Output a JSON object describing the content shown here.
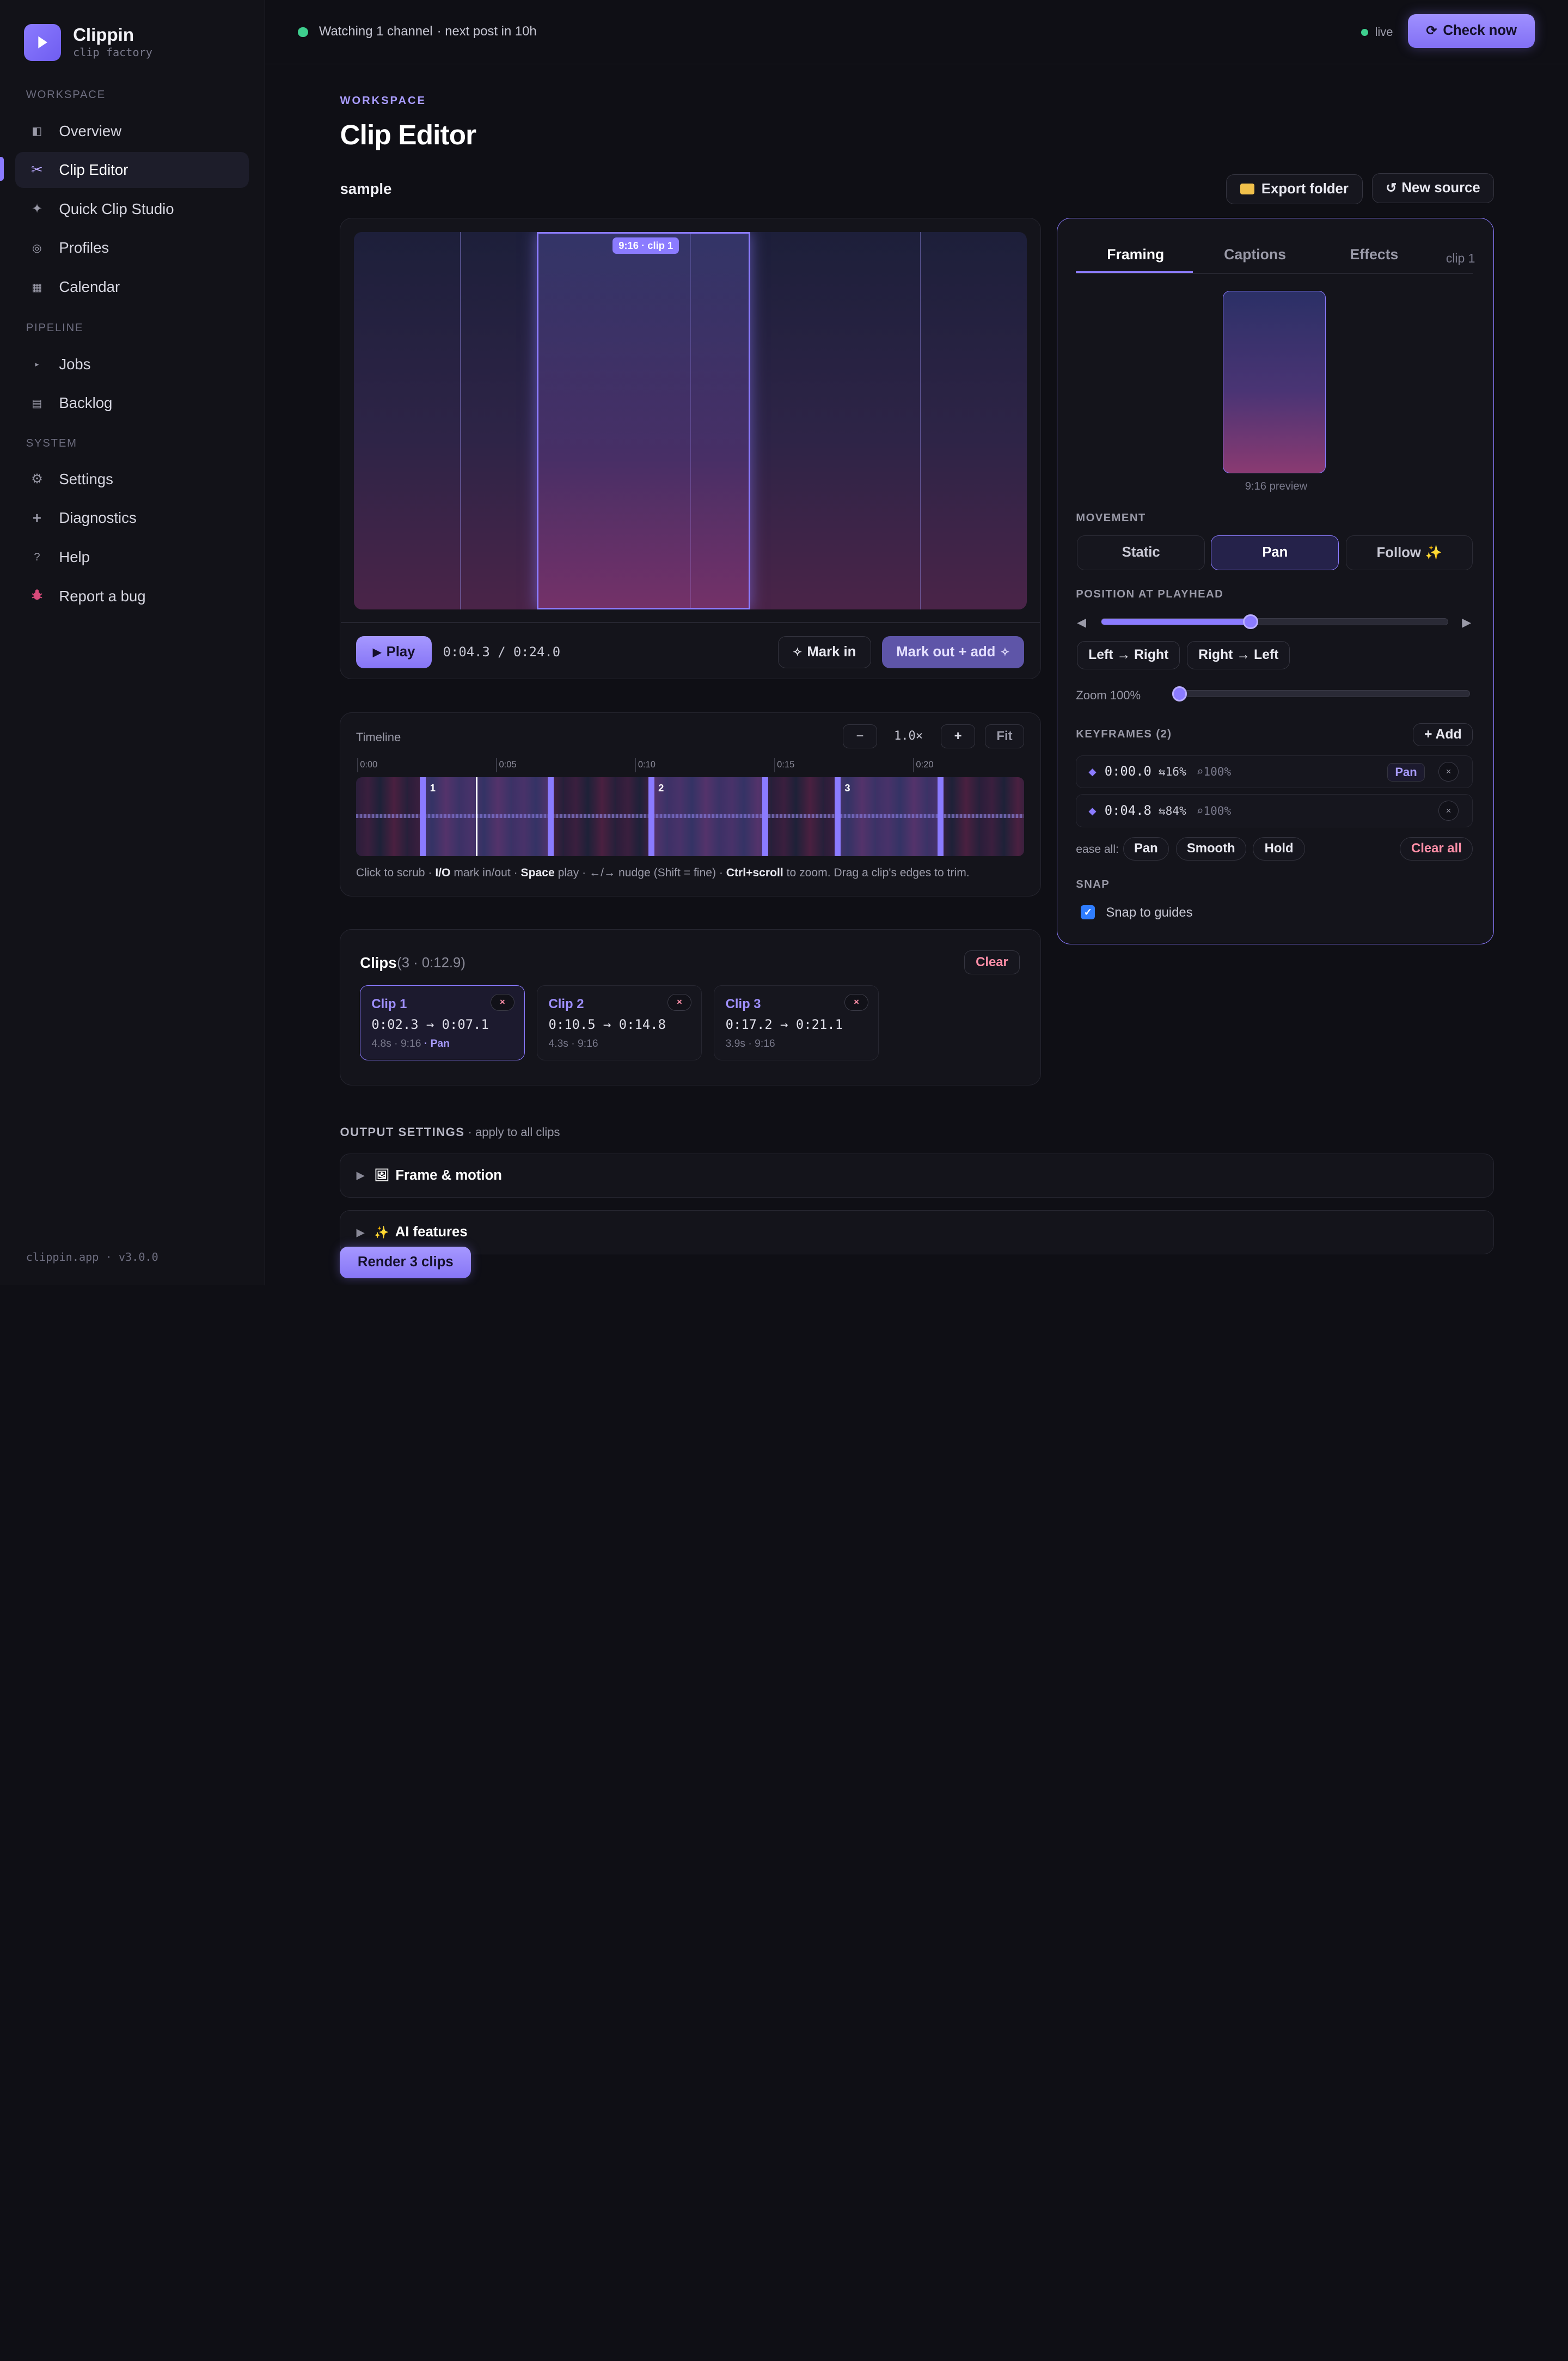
{
  "app": {
    "name": "Clippin",
    "tagline": "clip factory",
    "footer": "clippin.app · v3.0.0",
    "accent": "#8b7bff"
  },
  "sidebar": {
    "sections": [
      {
        "label": "WORKSPACE",
        "items": [
          {
            "label": "Overview",
            "icon": "overview-icon"
          },
          {
            "label": "Clip Editor",
            "icon": "scissors-icon",
            "active": true
          },
          {
            "label": "Quick Clip Studio",
            "icon": "sparkle-icon"
          },
          {
            "label": "Profiles",
            "icon": "profile-icon"
          },
          {
            "label": "Calendar",
            "icon": "calendar-icon"
          }
        ]
      },
      {
        "label": "PIPELINE",
        "items": [
          {
            "label": "Jobs",
            "icon": "play-small-icon"
          },
          {
            "label": "Backlog",
            "icon": "list-icon"
          }
        ]
      },
      {
        "label": "SYSTEM",
        "items": [
          {
            "label": "Settings",
            "icon": "gear-icon"
          },
          {
            "label": "Diagnostics",
            "icon": "plus-icon"
          },
          {
            "label": "Help",
            "icon": "question-icon"
          },
          {
            "label": "Report a bug",
            "icon": "bug-icon"
          }
        ]
      }
    ]
  },
  "topbar": {
    "status": "Watching 1 channel",
    "next_post": "· next post in 10h",
    "live": "live",
    "check_button": "Check now"
  },
  "header": {
    "eyebrow": "WORKSPACE",
    "title": "Clip Editor",
    "source": "sample",
    "export_button": "Export folder",
    "new_source_button": "New source"
  },
  "preview": {
    "crop_tag": "9:16 · clip 1",
    "play_button": "Play",
    "timecode": "0:04.3 / 0:24.0",
    "mark_in_button": "Mark in",
    "mark_out_button": "Mark out + add"
  },
  "timeline": {
    "label": "Timeline",
    "zoom_out": "−",
    "zoom_level": "1.0×",
    "zoom_in": "+",
    "fit": "Fit",
    "ticks": [
      "0:00",
      "0:05",
      "0:10",
      "0:15",
      "0:20"
    ],
    "duration_seconds": 24.0,
    "playhead_seconds": 4.3,
    "clips": [
      {
        "num": "1",
        "start": 2.3,
        "end": 7.1
      },
      {
        "num": "2",
        "start": 10.5,
        "end": 14.8
      },
      {
        "num": "3",
        "start": 17.2,
        "end": 21.1
      }
    ],
    "hint": {
      "p1": "Click to scrub · ",
      "k1": "I/O",
      "p2": " mark in/out · ",
      "k2": "Space",
      "p3": " play · ←/→ nudge (Shift = fine) · ",
      "k3": "Ctrl+scroll",
      "p4": " to zoom. Drag a clip's edges to trim."
    }
  },
  "clips": {
    "title": "Clips",
    "meta": "(3 · 0:12.9)",
    "clear_button": "Clear",
    "items": [
      {
        "name": "Clip 1",
        "range": "0:02.3 → 0:07.1",
        "meta": "4.8s · 9:16",
        "tag": "· Pan",
        "remove": "×"
      },
      {
        "name": "Clip 2",
        "range": "0:10.5 → 0:14.8",
        "meta": "4.3s · 9:16",
        "tag": "",
        "remove": "×"
      },
      {
        "name": "Clip 3",
        "range": "0:17.2 → 0:21.1",
        "meta": "3.9s · 9:16",
        "tag": "",
        "remove": "×"
      }
    ]
  },
  "output": {
    "heading": "OUTPUT SETTINGS",
    "subheading": "· apply to all clips",
    "sections": [
      {
        "label": "Frame & motion",
        "emoji": "🖼"
      },
      {
        "label": "AI features",
        "emoji": "✨"
      }
    ],
    "render_button": "Render 3 clips"
  },
  "panel": {
    "tabs": [
      "Framing",
      "Captions",
      "Effects"
    ],
    "active_tab": "Framing",
    "clip_label": "clip 1",
    "preview_label": "9:16 preview",
    "movement_label": "MOVEMENT",
    "movement_options": [
      "Static",
      "Pan",
      "Follow ✨"
    ],
    "movement_selected": "Pan",
    "position_label": "POSITION AT PLAYHEAD",
    "position_value": 0.43,
    "ltr_button": "Left → Right",
    "rtl_button": "Right → Left",
    "zoom_label": "Zoom 100%",
    "zoom_value": 0,
    "keyframes_label": "KEYFRAMES (2)",
    "add_button": "+ Add",
    "keyframes": [
      {
        "time": "0:00.0",
        "pos": "⇆16%",
        "zoom": "⌕100%",
        "tag": "Pan",
        "remove": "×"
      },
      {
        "time": "0:04.8",
        "pos": "⇆84%",
        "zoom": "⌕100%",
        "tag": "",
        "remove": "×"
      }
    ],
    "ease_label": "ease all:",
    "ease_options": [
      "Pan",
      "Smooth",
      "Hold"
    ],
    "clear_all": "Clear all",
    "snap_label": "SNAP",
    "snap_option": "Snap to guides",
    "snap_checked": true
  }
}
